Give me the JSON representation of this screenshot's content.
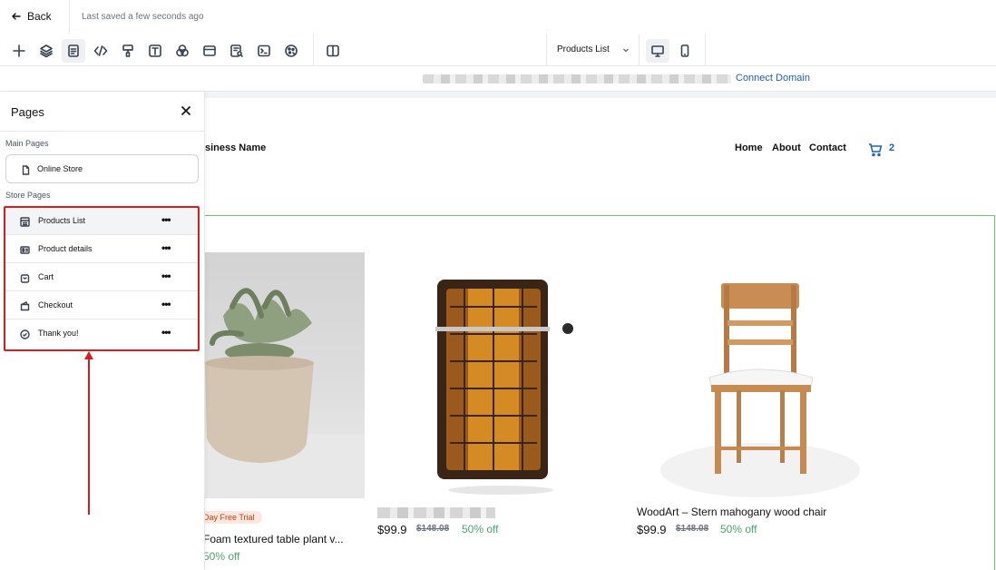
{
  "topbar": {
    "back_label": "Back",
    "saved_status": "Last saved a few seconds ago"
  },
  "toolbar": {
    "icons": [
      "plus-icon",
      "layers-icon",
      "pages-icon",
      "code-icon",
      "paint-icon",
      "text-icon",
      "color-icon",
      "layout-icon",
      "search-page-icon",
      "terminal-icon",
      "settings-icon",
      "split-view-icon"
    ],
    "page_select": "Products List",
    "devices": [
      "desktop-icon",
      "mobile-icon"
    ]
  },
  "addressbar": {
    "connect_domain": "Connect Domain"
  },
  "panel": {
    "title": "Pages",
    "main_pages_label": "Main Pages",
    "main_pages": [
      {
        "label": "Online Store",
        "icon": "page-icon"
      }
    ],
    "store_pages_label": "Store Pages",
    "store_pages": [
      {
        "label": "Products List",
        "icon": "list-icon",
        "active": true
      },
      {
        "label": "Product details",
        "icon": "details-icon",
        "active": false
      },
      {
        "label": "Cart",
        "icon": "bag-icon",
        "active": false
      },
      {
        "label": "Checkout",
        "icon": "wallet-icon",
        "active": false
      },
      {
        "label": "Thank you!",
        "icon": "check-circle-icon",
        "active": false
      }
    ],
    "more_symbol": "•••"
  },
  "site": {
    "business_name": "siness Name",
    "nav": [
      "Home",
      "About",
      "Contact"
    ],
    "cart_count": "2"
  },
  "products": [
    {
      "badge": "Day Free Trial",
      "title": "Foam textured table plant v...",
      "price": "",
      "old_price": "",
      "discount": "50% off"
    },
    {
      "title": "",
      "price": "$99.9",
      "old_price": "$148.08",
      "discount": "50% off"
    },
    {
      "title": "WoodArt – Stern mahogany wood chair",
      "price": "$99.9",
      "old_price": "$148.08",
      "discount": "50% off"
    }
  ],
  "colors": {
    "accent_blue": "#1d5fb4",
    "annotation_red": "#d91c1c",
    "discount_green": "#4ca56a",
    "selection_green": "#6fc26f"
  }
}
